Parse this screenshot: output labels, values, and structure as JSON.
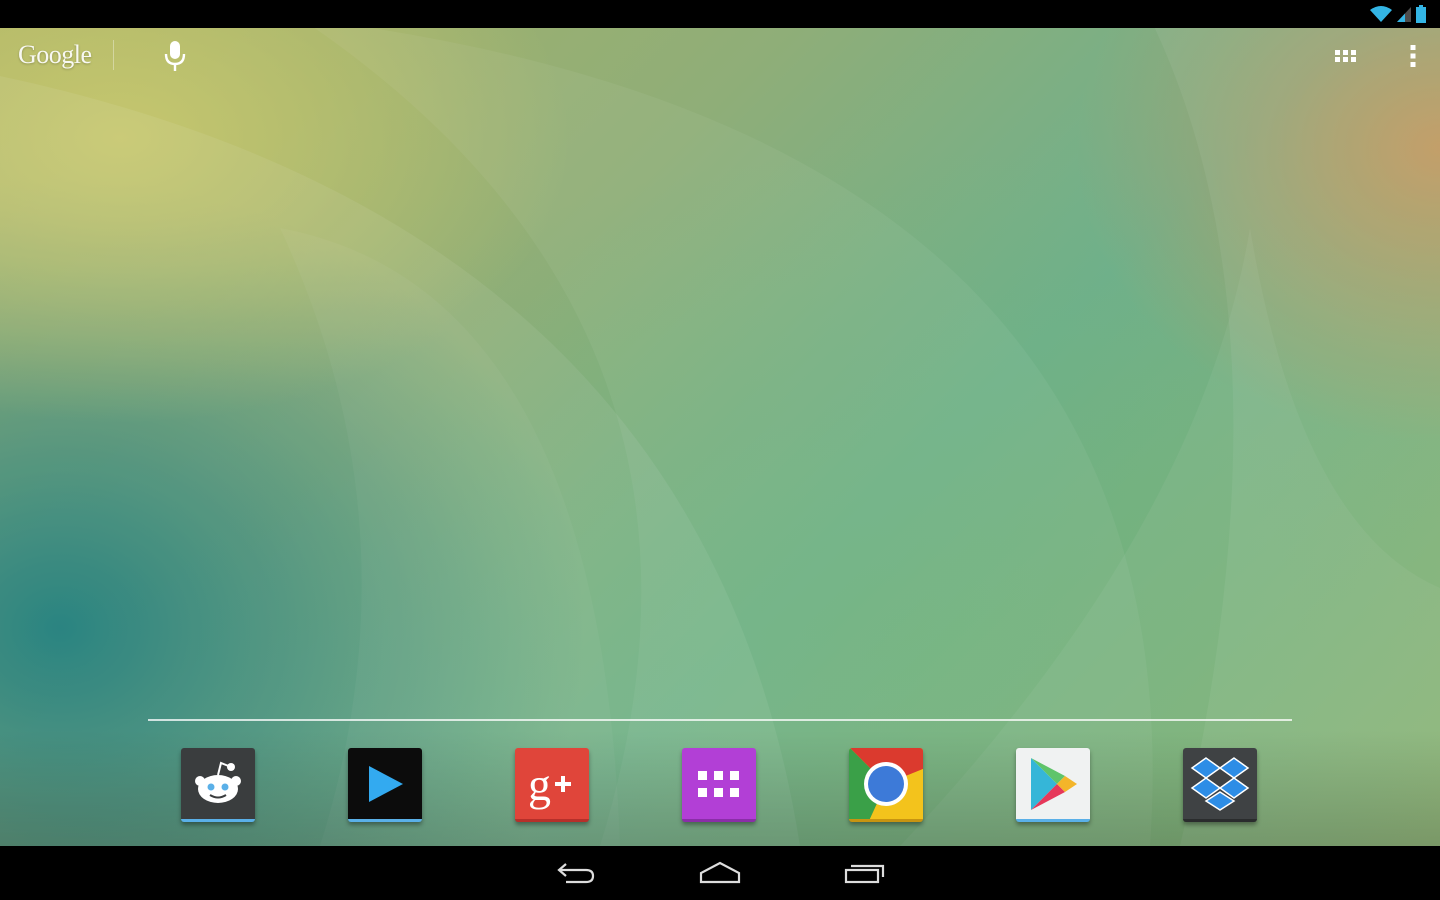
{
  "search_bar": {
    "logo_text": "Google",
    "mic_icon": "microphone-icon",
    "apps_icon": "app-grid-icon",
    "overflow_icon": "overflow-menu-icon"
  },
  "status_bar": {
    "icons": [
      "wifi-icon",
      "cell-signal-icon",
      "battery-icon"
    ],
    "accent_color": "#33b5e5"
  },
  "dock": {
    "apps": [
      {
        "name": "reddit",
        "icon": "reddit-alien-icon",
        "color": "#3a3d3e"
      },
      {
        "name": "video-player",
        "icon": "play-triangle-icon",
        "color": "#0c0c0c"
      },
      {
        "name": "google-plus",
        "icon": "google-plus-icon",
        "color": "#e0453a"
      },
      {
        "name": "app-drawer",
        "icon": "app-drawer-icon",
        "color": "#b23fd6"
      },
      {
        "name": "chrome",
        "icon": "chrome-icon",
        "color": "#e8b21f"
      },
      {
        "name": "play-store",
        "icon": "play-store-icon",
        "color": "#f0f2f2"
      },
      {
        "name": "dropbox",
        "icon": "dropbox-icon",
        "color": "#3f4244"
      }
    ]
  },
  "nav_bar": {
    "buttons": [
      "back-icon",
      "home-icon",
      "recents-icon"
    ]
  }
}
